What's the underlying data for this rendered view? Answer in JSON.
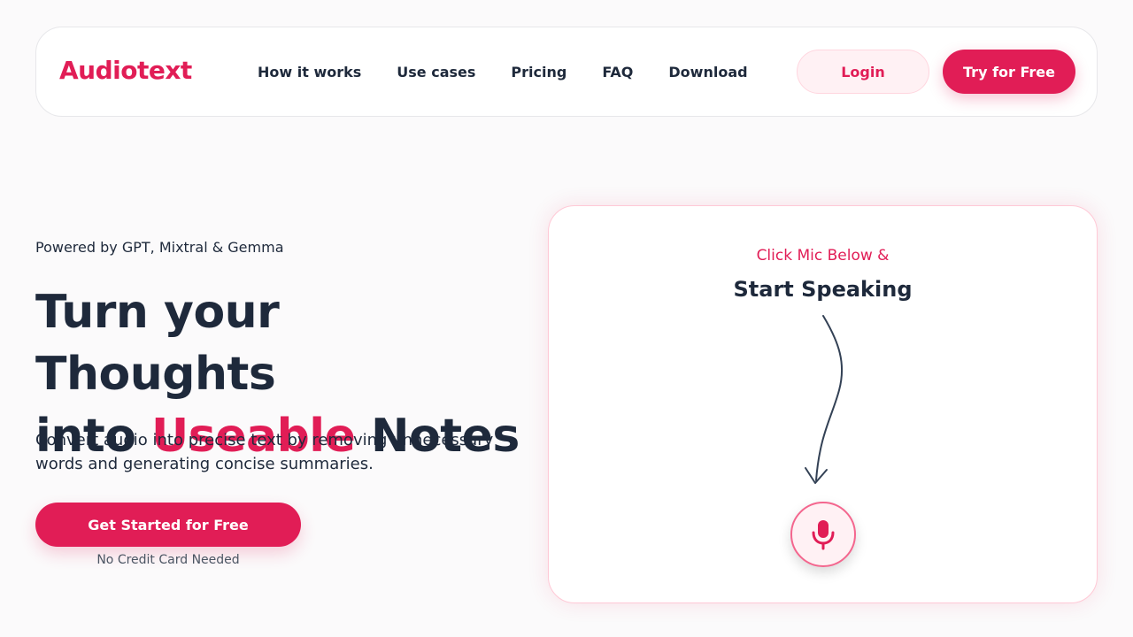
{
  "colors": {
    "accent": "#e11d56",
    "text": "#1e293b",
    "background": "#fbfafb"
  },
  "nav": {
    "logo": "Audiotext",
    "links": [
      "How it works",
      "Use cases",
      "Pricing",
      "FAQ",
      "Download"
    ],
    "login_label": "Login",
    "try_label": "Try for Free"
  },
  "hero": {
    "eyebrow": "Powered by GPT, Mixtral & Gemma",
    "title_line1": "Turn your Thoughts",
    "title_line2_prefix": "into ",
    "title_line2_accent": "Useable",
    "title_line2_suffix": " Notes",
    "subtitle": "Convert audio into precise text by removing unnecessary words and generating concise summaries.",
    "cta_label": "Get Started for Free",
    "cta_note": "No Credit Card Needed"
  },
  "recorder": {
    "hint": "Click Mic Below &",
    "title": "Start Speaking",
    "arrow_icon": "curved-arrow-down-icon",
    "mic_icon": "microphone-icon"
  }
}
